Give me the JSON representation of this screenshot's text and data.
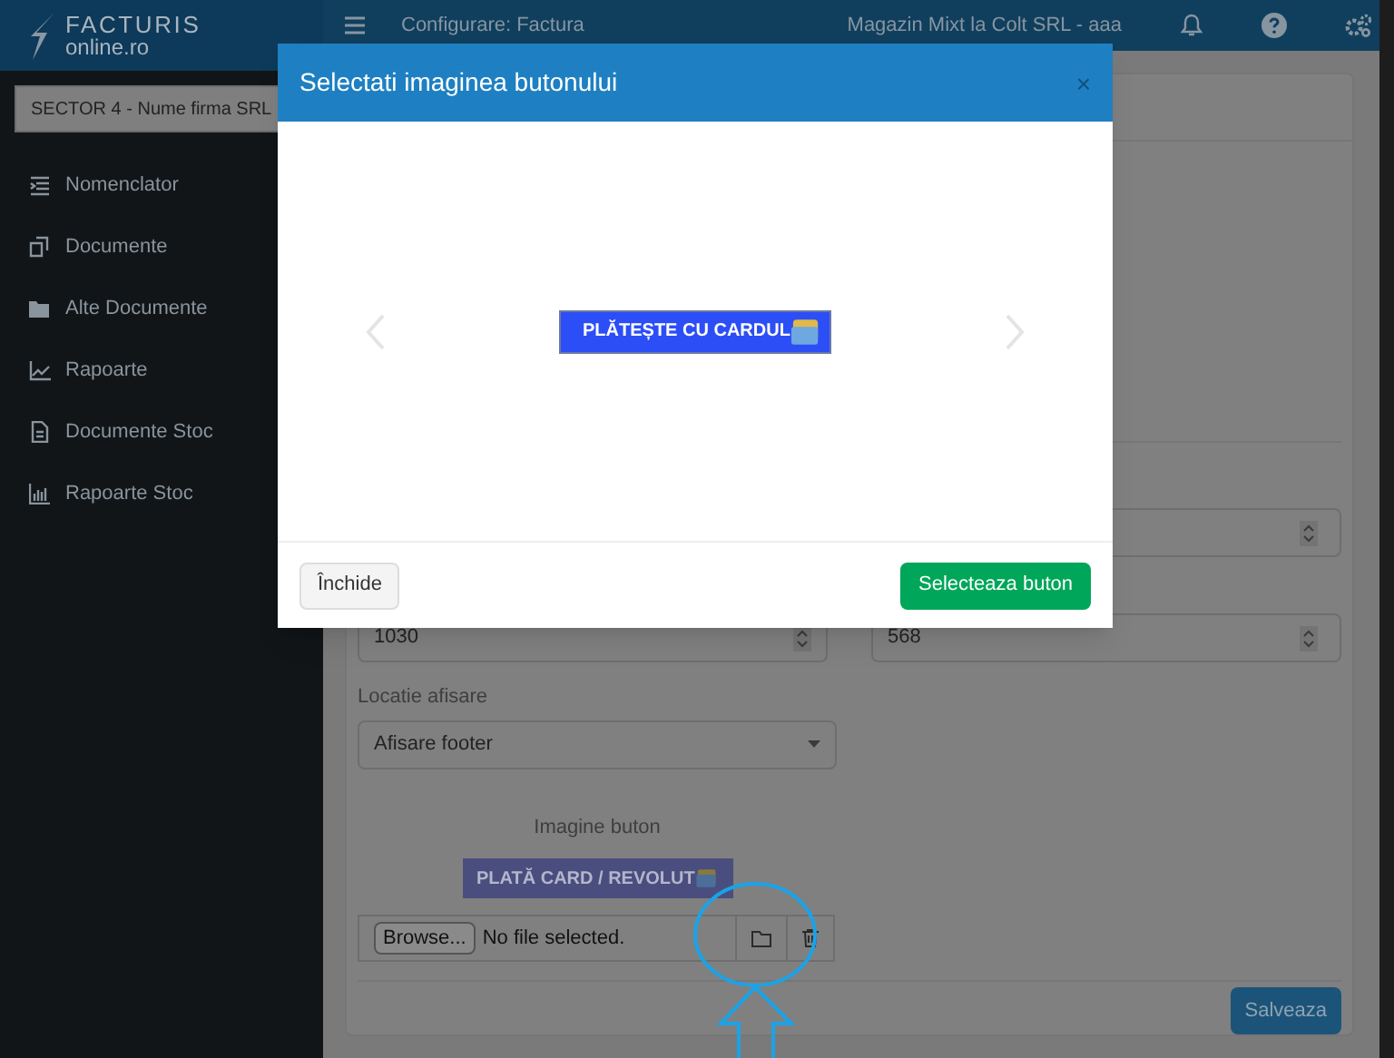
{
  "header": {
    "logo_top": "FACTURIS",
    "logo_bottom": "online.ro",
    "title": "Configurare: Factura",
    "company": "Magazin Mixt la Colt SRL - aaa"
  },
  "sidebar": {
    "company_select": "SECTOR 4 - Nume firma SRL",
    "items": [
      {
        "label": "Nomenclator",
        "kind": "list"
      },
      {
        "label": "Documente",
        "kind": "copy"
      },
      {
        "label": "Alte Documente",
        "kind": "folder"
      },
      {
        "label": "Rapoarte",
        "kind": "chart"
      },
      {
        "label": "Documente Stoc",
        "kind": "file"
      },
      {
        "label": "Rapoarte Stoc",
        "kind": "bars"
      }
    ]
  },
  "form": {
    "width_value": "1030",
    "height_value": "568",
    "location_label": "Locatie afisare",
    "location_value": "Afisare footer",
    "image_label": "Imagine buton",
    "image_text": "PLATĂ CARD / REVOLUT",
    "browse_button": "Browse...",
    "file_status": "No file selected.",
    "save_button": "Salveaza"
  },
  "modal": {
    "title": "Selectati imaginea butonului",
    "close": "×",
    "slide_text": "PLĂTEȘTE CU CARDUL",
    "close_button": "Închide",
    "select_button": "Selecteaza buton"
  }
}
